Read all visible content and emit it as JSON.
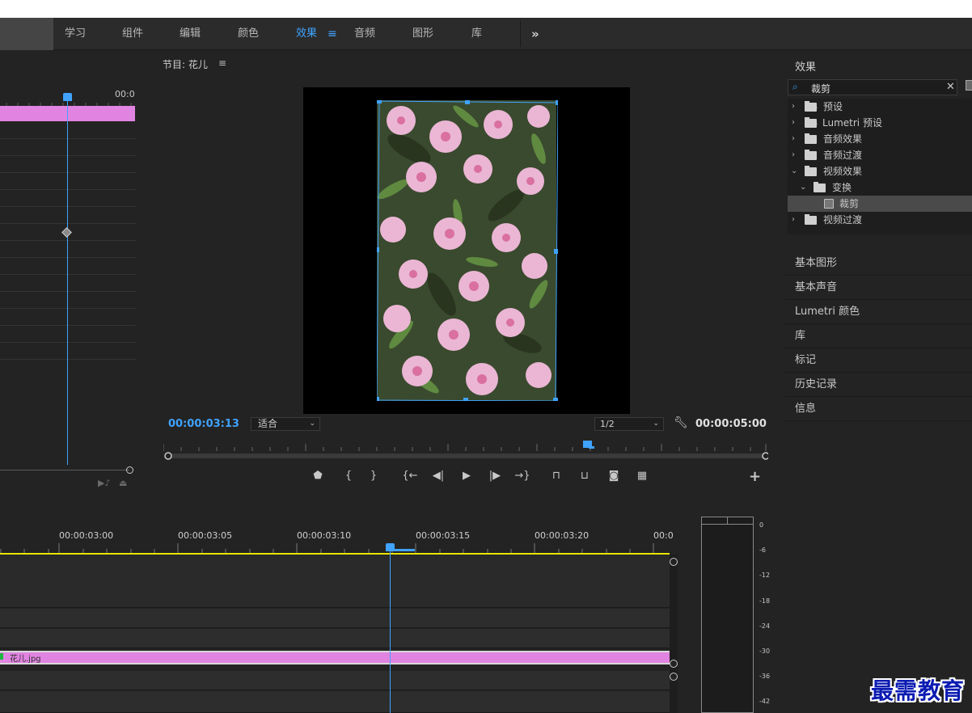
{
  "workspace": {
    "tabs": [
      {
        "label": "学习",
        "active": false
      },
      {
        "label": "组件",
        "active": false
      },
      {
        "label": "编辑",
        "active": false
      },
      {
        "label": "颜色",
        "active": false
      },
      {
        "label": "效果",
        "active": true
      },
      {
        "label": "音频",
        "active": false
      },
      {
        "label": "图形",
        "active": false
      },
      {
        "label": "库",
        "active": false
      }
    ],
    "menu_icon": "≡",
    "overflow_icon": "»"
  },
  "effect_controls": {
    "ruler_timecode": "00:0"
  },
  "program_monitor": {
    "title": "节目: 花儿",
    "title_menu_icon": "≡",
    "current_timecode": "00:00:03:13",
    "zoom_select": "适合",
    "resolution_select": "1/2",
    "duration": "00:00:05:00",
    "playhead_fraction": 0.7
  },
  "effects_panel": {
    "title": "效果",
    "search_value": "裁剪",
    "tree": [
      {
        "label": "预设",
        "level": 0,
        "expanded": false,
        "type": "preset-folder"
      },
      {
        "label": "Lumetri 预设",
        "level": 0,
        "expanded": false,
        "type": "preset-folder"
      },
      {
        "label": "音频效果",
        "level": 0,
        "expanded": false,
        "type": "folder"
      },
      {
        "label": "音频过渡",
        "level": 0,
        "expanded": false,
        "type": "folder"
      },
      {
        "label": "视频效果",
        "level": 0,
        "expanded": true,
        "type": "folder"
      },
      {
        "label": "变换",
        "level": 1,
        "expanded": true,
        "type": "folder"
      },
      {
        "label": "裁剪",
        "level": 2,
        "expanded": false,
        "type": "effect",
        "selected": true
      },
      {
        "label": "视频过渡",
        "level": 0,
        "expanded": false,
        "type": "folder"
      }
    ]
  },
  "side_panels": [
    "基本图形",
    "基本声音",
    "Lumetri 颜色",
    "库",
    "标记",
    "历史记录",
    "信息"
  ],
  "timeline": {
    "timecodes": [
      "00:00:03:00",
      "00:00:03:05",
      "00:00:03:10",
      "00:00:03:15",
      "00:00:03:20",
      "00:0"
    ],
    "clip_name": "花儿.jpg"
  },
  "audio_meter": {
    "scale": [
      "0",
      "-6",
      "-12",
      "-18",
      "-24",
      "-30",
      "-36",
      "-42"
    ]
  },
  "watermark": "最需教育",
  "colors": {
    "accent": "#3fa3ff",
    "clip_pink": "#e184e1",
    "in_out_yellow": "#e6e600",
    "panel_bg": "#232323"
  }
}
